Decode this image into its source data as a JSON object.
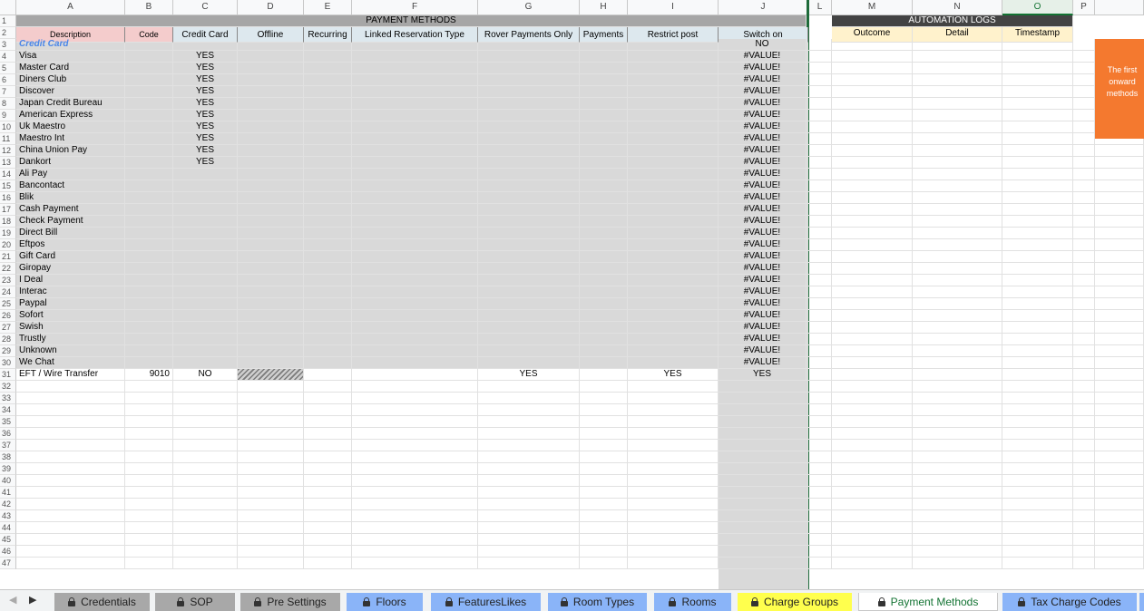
{
  "columns": [
    "A",
    "B",
    "C",
    "D",
    "E",
    "F",
    "G",
    "H",
    "I",
    "J",
    "L",
    "M",
    "N",
    "O",
    "P"
  ],
  "selected_column": "O",
  "headers": {
    "payment_methods_title": "PAYMENT METHODS",
    "automation_logs_title": "AUTOMATION LOGS",
    "description": "Description",
    "code": "Code",
    "credit_card": "Credit Card",
    "offline": "Offline",
    "recurring": "Recurring",
    "linked_reservation_type": "Linked Reservation Type",
    "rover_payments_only": "Rover Payments Only",
    "payments": "Payments",
    "restrict_post": "Restrict post",
    "switch_on": "Switch on",
    "outcome": "Outcome",
    "detail": "Detail",
    "timestamp": "Timestamp"
  },
  "note_text": "The first onward methods",
  "row_numbers": [
    "1",
    "2",
    "3",
    "4",
    "5",
    "6",
    "7",
    "8",
    "9",
    "10",
    "11",
    "12",
    "13",
    "14",
    "15",
    "16",
    "17",
    "18",
    "19",
    "20",
    "21",
    "22",
    "23",
    "24",
    "25",
    "26",
    "27",
    "28",
    "29",
    "30",
    "31",
    "32",
    "33",
    "34",
    "35",
    "36",
    "37",
    "38",
    "39",
    "40",
    "41",
    "42",
    "43",
    "44",
    "45",
    "46",
    "47"
  ],
  "rows": [
    {
      "desc": "Credit Card",
      "code": "",
      "cc": "",
      "g": "",
      "i": "",
      "j": "NO",
      "category": true
    },
    {
      "desc": "Visa",
      "code": "",
      "cc": "YES",
      "g": "",
      "i": "",
      "j": "#VALUE!"
    },
    {
      "desc": "Master Card",
      "code": "",
      "cc": "YES",
      "g": "",
      "i": "",
      "j": "#VALUE!"
    },
    {
      "desc": "Diners Club",
      "code": "",
      "cc": "YES",
      "g": "",
      "i": "",
      "j": "#VALUE!"
    },
    {
      "desc": "Discover",
      "code": "",
      "cc": "YES",
      "g": "",
      "i": "",
      "j": "#VALUE!"
    },
    {
      "desc": "Japan Credit Bureau",
      "code": "",
      "cc": "YES",
      "g": "",
      "i": "",
      "j": "#VALUE!"
    },
    {
      "desc": "American Express",
      "code": "",
      "cc": "YES",
      "g": "",
      "i": "",
      "j": "#VALUE!"
    },
    {
      "desc": "Uk Maestro",
      "code": "",
      "cc": "YES",
      "g": "",
      "i": "",
      "j": "#VALUE!"
    },
    {
      "desc": "Maestro Int",
      "code": "",
      "cc": "YES",
      "g": "",
      "i": "",
      "j": "#VALUE!"
    },
    {
      "desc": "China Union Pay",
      "code": "",
      "cc": "YES",
      "g": "",
      "i": "",
      "j": "#VALUE!"
    },
    {
      "desc": "Dankort",
      "code": "",
      "cc": "YES",
      "g": "",
      "i": "",
      "j": "#VALUE!"
    },
    {
      "desc": "Ali Pay",
      "code": "",
      "cc": "",
      "g": "",
      "i": "",
      "j": "#VALUE!"
    },
    {
      "desc": "Bancontact",
      "code": "",
      "cc": "",
      "g": "",
      "i": "",
      "j": "#VALUE!"
    },
    {
      "desc": "Blik",
      "code": "",
      "cc": "",
      "g": "",
      "i": "",
      "j": "#VALUE!"
    },
    {
      "desc": "Cash Payment",
      "code": "",
      "cc": "",
      "g": "",
      "i": "",
      "j": "#VALUE!"
    },
    {
      "desc": "Check Payment",
      "code": "",
      "cc": "",
      "g": "",
      "i": "",
      "j": "#VALUE!"
    },
    {
      "desc": "Direct Bill",
      "code": "",
      "cc": "",
      "g": "",
      "i": "",
      "j": "#VALUE!"
    },
    {
      "desc": "Eftpos",
      "code": "",
      "cc": "",
      "g": "",
      "i": "",
      "j": "#VALUE!"
    },
    {
      "desc": "Gift Card",
      "code": "",
      "cc": "",
      "g": "",
      "i": "",
      "j": "#VALUE!"
    },
    {
      "desc": "Giropay",
      "code": "",
      "cc": "",
      "g": "",
      "i": "",
      "j": "#VALUE!"
    },
    {
      "desc": "I Deal",
      "code": "",
      "cc": "",
      "g": "",
      "i": "",
      "j": "#VALUE!"
    },
    {
      "desc": "Interac",
      "code": "",
      "cc": "",
      "g": "",
      "i": "",
      "j": "#VALUE!"
    },
    {
      "desc": "Paypal",
      "code": "",
      "cc": "",
      "g": "",
      "i": "",
      "j": "#VALUE!"
    },
    {
      "desc": "Sofort",
      "code": "",
      "cc": "",
      "g": "",
      "i": "",
      "j": "#VALUE!"
    },
    {
      "desc": "Swish",
      "code": "",
      "cc": "",
      "g": "",
      "i": "",
      "j": "#VALUE!"
    },
    {
      "desc": "Trustly",
      "code": "",
      "cc": "",
      "g": "",
      "i": "",
      "j": "#VALUE!"
    },
    {
      "desc": "Unknown",
      "code": "",
      "cc": "",
      "g": "",
      "i": "",
      "j": "#VALUE!"
    },
    {
      "desc": "We Chat",
      "code": "",
      "cc": "",
      "g": "",
      "i": "",
      "j": "#VALUE!"
    },
    {
      "desc": "EFT / Wire Transfer",
      "code": "9010",
      "cc": "NO",
      "g": "YES",
      "i": "YES",
      "j": "YES",
      "hatched_offline": true
    }
  ],
  "tabs": [
    {
      "label": "Credentials",
      "locked": true,
      "color": "#a8a8a8",
      "active": false
    },
    {
      "label": "SOP",
      "locked": true,
      "color": "#a8a8a8",
      "active": false
    },
    {
      "label": "Pre Settings",
      "locked": true,
      "color": "#a8a8a8",
      "active": false
    },
    {
      "label": "Floors",
      "locked": true,
      "color": "#8ab4f8",
      "active": false
    },
    {
      "label": "FeaturesLikes",
      "locked": true,
      "color": "#8ab4f8",
      "active": false
    },
    {
      "label": "Room Types",
      "locked": true,
      "color": "#8ab4f8",
      "active": false
    },
    {
      "label": "Rooms",
      "locked": true,
      "color": "#8ab4f8",
      "active": false
    },
    {
      "label": "Charge Groups",
      "locked": true,
      "color": "#ffff4d",
      "active": false
    },
    {
      "label": "Payment Methods",
      "locked": true,
      "color": "#ffffff",
      "active": true
    },
    {
      "label": "Tax Charge Codes",
      "locked": true,
      "color": "#8ab4f8",
      "active": false
    }
  ],
  "colors": {
    "title_band": "#a6a6a6",
    "header_pink": "#f4cccc",
    "header_blue": "#dde8ee",
    "body_gray": "#d9d9d9",
    "log_title": "#434343",
    "log_header": "#fff2cc",
    "note_orange": "#f4792f",
    "category_blue": "#4a86e8",
    "active_tab_text": "#137333"
  }
}
